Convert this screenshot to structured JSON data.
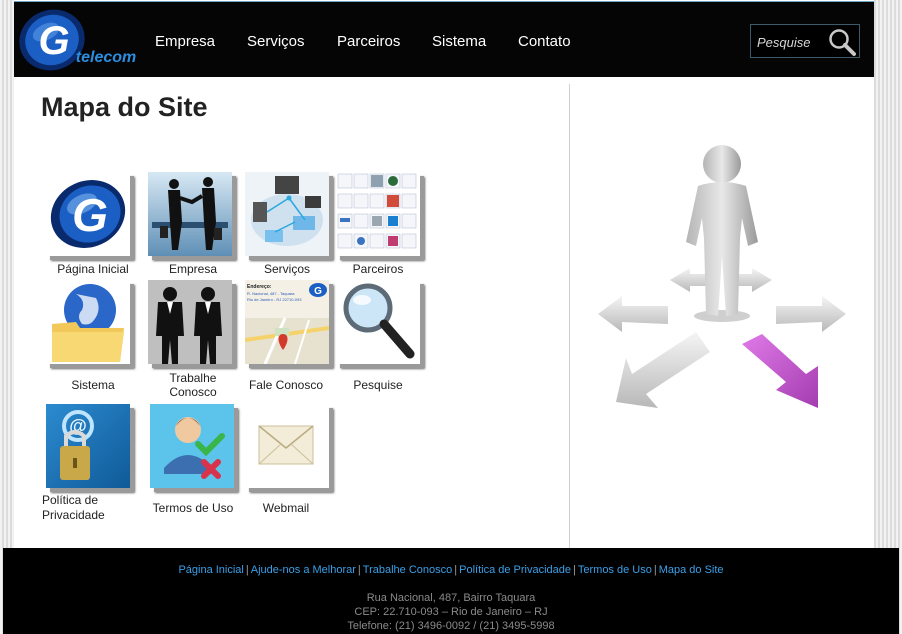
{
  "header": {
    "logo_text": "G telecom",
    "nav": [
      "Empresa",
      "Serviços",
      "Parceiros",
      "Sistema",
      "Contato"
    ],
    "search_placeholder": "Pesquise"
  },
  "main": {
    "title": "Mapa do Site",
    "tiles": [
      {
        "label": "Página Inicial"
      },
      {
        "label": "Empresa"
      },
      {
        "label": "Serviços"
      },
      {
        "label": "Parceiros"
      },
      {
        "label": "Sistema"
      },
      {
        "label_l1": "Trabalhe",
        "label_l2": "Conosco"
      },
      {
        "label": "Fale Conosco"
      },
      {
        "label": "Pesquise"
      },
      {
        "label_l1": "Política de",
        "label_l2": "Privacidade"
      },
      {
        "label": "Termos de Uso"
      },
      {
        "label": "Webmail"
      }
    ],
    "contact_thumb": {
      "l1": "Endereço:",
      "l2": "R. Nacional, 487 - Taquara",
      "l3": "Rio de Janeiro - RJ 22710-093"
    }
  },
  "footer": {
    "links": [
      "Página Inicial",
      "Ajude-nos a Melhorar",
      "Trabalhe Conosco",
      "Política de Privacidade",
      "Termos de Uso",
      "Mapa do Site"
    ],
    "address": "Rua Nacional, 487, Bairro Taquara",
    "cep": "CEP: 22.710-093 – Rio de Janeiro – RJ",
    "phone": "Telefone: (21) 3496-0092 / (21) 3495-5998"
  }
}
